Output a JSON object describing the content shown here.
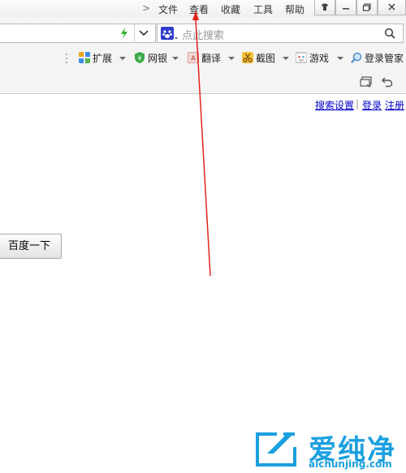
{
  "menu": {
    "chevron": ">",
    "items": [
      "文件",
      "查看",
      "收藏",
      "工具",
      "帮助"
    ]
  },
  "search": {
    "placeholder": "点此搜索"
  },
  "extensions": {
    "items": [
      {
        "label": "扩展",
        "icon": "grid-icon"
      },
      {
        "label": "网银",
        "icon": "shield-yen-icon"
      },
      {
        "label": "翻译",
        "icon": "translate-icon"
      },
      {
        "label": "截图",
        "icon": "scissors-icon"
      },
      {
        "label": "游戏",
        "icon": "game-icon"
      },
      {
        "label": "登录管家",
        "icon": "key-search-icon"
      }
    ]
  },
  "page": {
    "links": {
      "settings": "搜索设置",
      "login": "登录",
      "register": "注册"
    },
    "separator": "|",
    "search_button": "百度一下"
  },
  "watermark": {
    "title": "爱纯净",
    "url": "aichunjing.com"
  },
  "colors": {
    "arrow": "#e2231a",
    "watermark": "#1a9fe0",
    "link": "#0000cc"
  }
}
